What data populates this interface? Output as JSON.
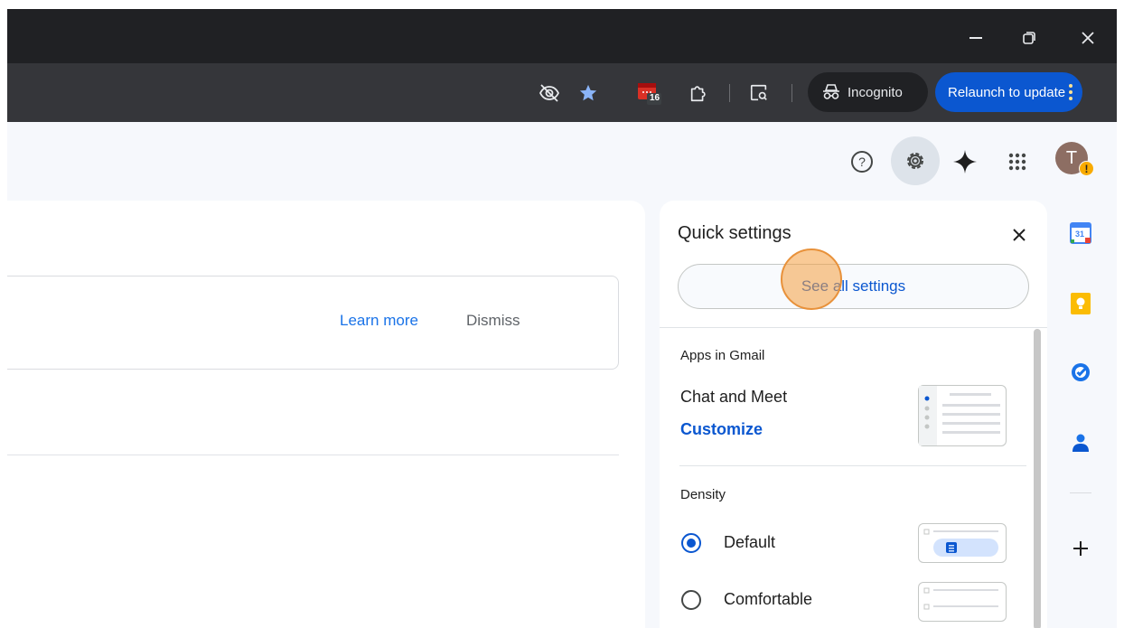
{
  "browser": {
    "window_controls": {
      "minimize_glyph": "—",
      "restore_glyph": "❐",
      "close_glyph": "✕"
    },
    "toolbar": {
      "calendar_badge": "16",
      "incognito_label": "Incognito",
      "relaunch_label": "Relaunch to update",
      "menu_glyph": "⋮"
    },
    "icons": [
      "eye-off-icon",
      "bookmark-star-icon",
      "calendar-extension-icon",
      "extensions-puzzle-icon",
      "lens-search-icon",
      "incognito-icon",
      "more-vert-icon"
    ]
  },
  "gmail": {
    "header": {
      "help_glyph": "?",
      "avatar_initial": "T",
      "avatar_warning": "!"
    },
    "banner": {
      "learn_more": "Learn more",
      "dismiss": "Dismiss"
    },
    "quick_settings": {
      "title": "Quick settings",
      "close_glyph": "✕",
      "see_all": "See all settings",
      "apps_section": {
        "label": "Apps in Gmail",
        "chat_meet": "Chat and Meet",
        "customize": "Customize"
      },
      "density_section": {
        "label": "Density",
        "options": [
          {
            "label": "Default",
            "selected": true
          },
          {
            "label": "Comfortable",
            "selected": false
          }
        ]
      }
    },
    "side_rail": {
      "calendar_day": "31",
      "add_glyph": "+"
    }
  },
  "colors": {
    "accent": "#0b57d0",
    "link": "#1a73e8",
    "chrome_dark": "#202124",
    "chrome_toolbar": "#35363a",
    "click_marker": "#f49e40"
  }
}
